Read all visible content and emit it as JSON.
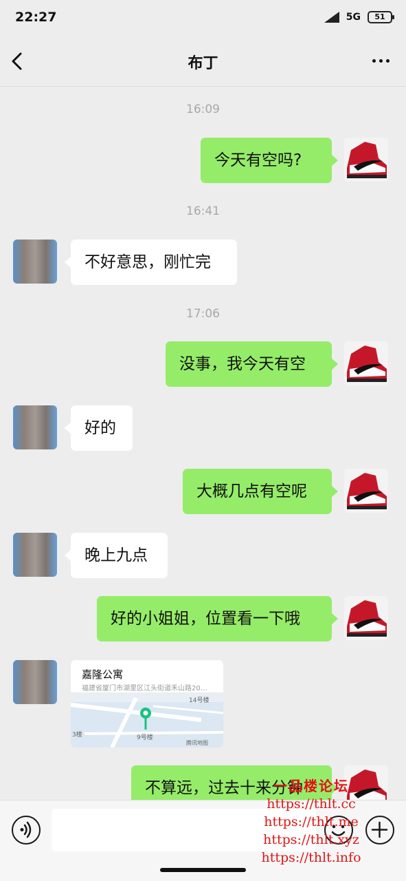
{
  "status_bar": {
    "time": "22:27",
    "network": "5G",
    "battery": "51"
  },
  "nav": {
    "title": "布丁"
  },
  "messages": [
    {
      "type": "time",
      "text": "16:09"
    },
    {
      "type": "text",
      "side": "right",
      "text": "今天有空吗?"
    },
    {
      "type": "time",
      "text": "16:41"
    },
    {
      "type": "text",
      "side": "left",
      "text": "不好意思，刚忙完"
    },
    {
      "type": "time",
      "text": "17:06"
    },
    {
      "type": "text",
      "side": "right",
      "text": "没事，我今天有空"
    },
    {
      "type": "text",
      "side": "left",
      "text": "好的"
    },
    {
      "type": "text",
      "side": "right",
      "text": "大概几点有空呢"
    },
    {
      "type": "text",
      "side": "left",
      "text": "晚上九点"
    },
    {
      "type": "text",
      "side": "right",
      "text": "好的小姐姐，位置看一下哦"
    },
    {
      "type": "location",
      "side": "left"
    },
    {
      "type": "text",
      "side": "right",
      "text": "不算远，过去十来分钟"
    }
  ],
  "location": {
    "title": "嘉隆公寓",
    "address": "福建省厦门市湖里区江头街道禾山路20…",
    "map_labels": [
      "14号楼",
      "9号楼",
      "3楼",
      "腾讯地图"
    ]
  },
  "input": {
    "placeholder": ""
  },
  "watermark": {
    "title": "一品楼论坛",
    "links": [
      "https://thlt.cc",
      "https://thlt.me",
      "https://thlt.xyz",
      "https://thlt.info"
    ]
  },
  "colors": {
    "background": "#ededed",
    "bubble_out": "#95ec69",
    "bubble_in": "#ffffff",
    "pin_green": "#19c37d",
    "watermark_red": "#e01515"
  },
  "icons": {
    "back": "chevron-left-icon",
    "more": "more-dots-icon",
    "voice": "voice-icon",
    "emoji": "emoji-icon",
    "plus": "plus-icon"
  }
}
